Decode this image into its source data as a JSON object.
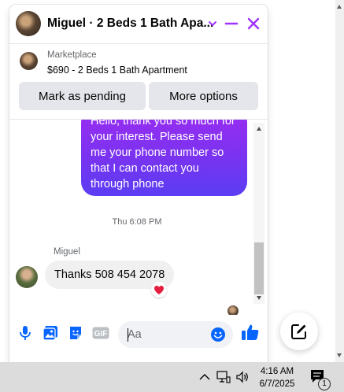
{
  "header": {
    "title": "Miguel · 2 Beds 1 Bath Apa...",
    "icons": [
      "chevron-down-icon",
      "minimize-icon",
      "close-icon"
    ],
    "accent": "#a033ff"
  },
  "marketplace": {
    "label": "Marketplace",
    "listing": "$690 - 2 Beds 1 Bath Apartment",
    "buttons": {
      "mark_pending": "Mark as pending",
      "more_options": "More options"
    }
  },
  "messages": {
    "outgoing_text": "Hello, thank you so much for your interest. Please send me your phone number so that I can contact you through phone",
    "timestamp": "Thu 6:08 PM",
    "sender_name": "Miguel",
    "incoming_text": "Thanks 508 454 2078",
    "reaction": "❤️"
  },
  "composer": {
    "placeholder": "Aa",
    "icons": [
      "microphone-icon",
      "photo-icon",
      "sticker-icon",
      "gif-icon",
      "emoji-icon",
      "thumbs-up-icon"
    ],
    "gif_label": "GIF"
  },
  "taskbar": {
    "time": "4:16 AM",
    "date": "6/7/2025",
    "notification_count": "1"
  },
  "colors": {
    "bubble_top": "#9b2cf2",
    "bubble_bottom": "#5b3df3",
    "blue_icon": "#0866ff"
  }
}
